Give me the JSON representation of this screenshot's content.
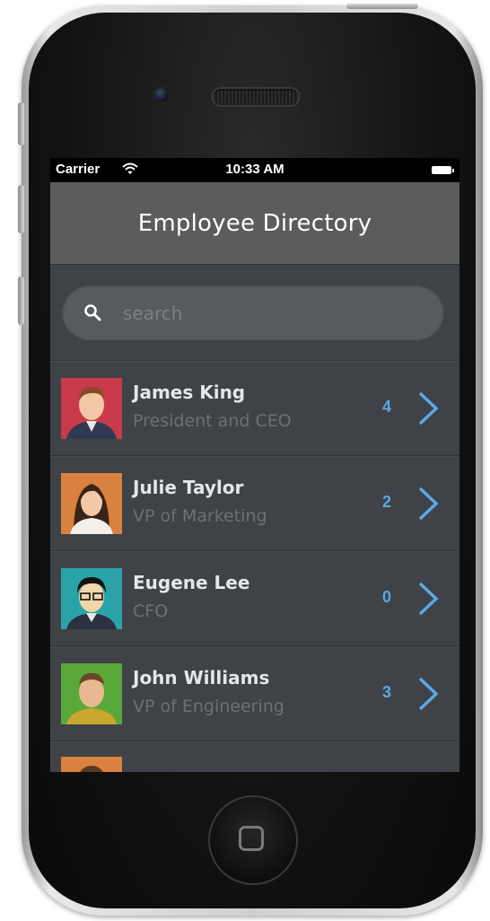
{
  "status_bar": {
    "carrier": "Carrier",
    "time": "10:33 AM"
  },
  "nav": {
    "title": "Employee Directory"
  },
  "search": {
    "placeholder": "search",
    "value": ""
  },
  "employees": [
    {
      "name": "James King",
      "title": "President and CEO",
      "count": "4",
      "avatar_bg": "#c93a4a"
    },
    {
      "name": "Julie Taylor",
      "title": "VP of Marketing",
      "count": "2",
      "avatar_bg": "#d9823f"
    },
    {
      "name": "Eugene Lee",
      "title": "CFO",
      "count": "0",
      "avatar_bg": "#2aa3a8"
    },
    {
      "name": "John Williams",
      "title": "VP of Engineering",
      "count": "3",
      "avatar_bg": "#5aa83a"
    }
  ],
  "colors": {
    "accent": "#5aa9e6",
    "nav_bg": "#5a5c5e",
    "list_bg": "#3f4246"
  },
  "icons": [
    "wifi-icon",
    "battery-icon",
    "search-icon",
    "chevron-right-icon",
    "home-button-icon"
  ]
}
